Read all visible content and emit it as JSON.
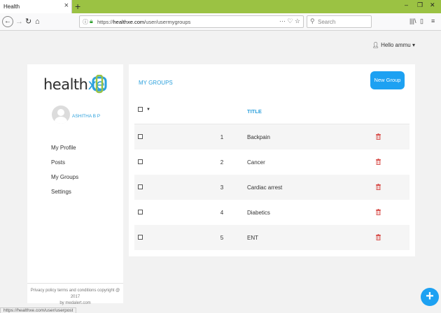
{
  "browser": {
    "tab_title": "Health",
    "tab_close": "×",
    "new_tab": "+",
    "url_prefix": "https://",
    "url_host": "healthxe.com",
    "url_path": "/user/usermygroups",
    "search_placeholder": "Search",
    "status_url": "https://healthxe.com/user/userpost"
  },
  "header": {
    "user_greeting": "Hello ammu"
  },
  "sidebar": {
    "logo_text_a": "health",
    "logo_text_b": "xe",
    "profile_name": "ASHITHA B P",
    "links": [
      "My Profile",
      "Posts",
      "My Groups",
      "Settings"
    ],
    "footer_line1": "Privacy policy terms and conditions copyright @ 2017",
    "footer_line2": "by medalert.com"
  },
  "main": {
    "title": "MY GROUPS",
    "new_group_label": "New Group",
    "table": {
      "title_header": "TITLE",
      "rows": [
        {
          "num": "1",
          "title": "Backpain"
        },
        {
          "num": "2",
          "title": "Cancer"
        },
        {
          "num": "3",
          "title": "Cardiac arrest"
        },
        {
          "num": "4",
          "title": "Diabetics"
        },
        {
          "num": "5",
          "title": "ENT"
        }
      ]
    }
  },
  "fab_label": "+",
  "colors": {
    "accent": "#2ba0dc",
    "button": "#1da1f2",
    "delete": "#d9534f",
    "tabbar": "#9bc243"
  }
}
